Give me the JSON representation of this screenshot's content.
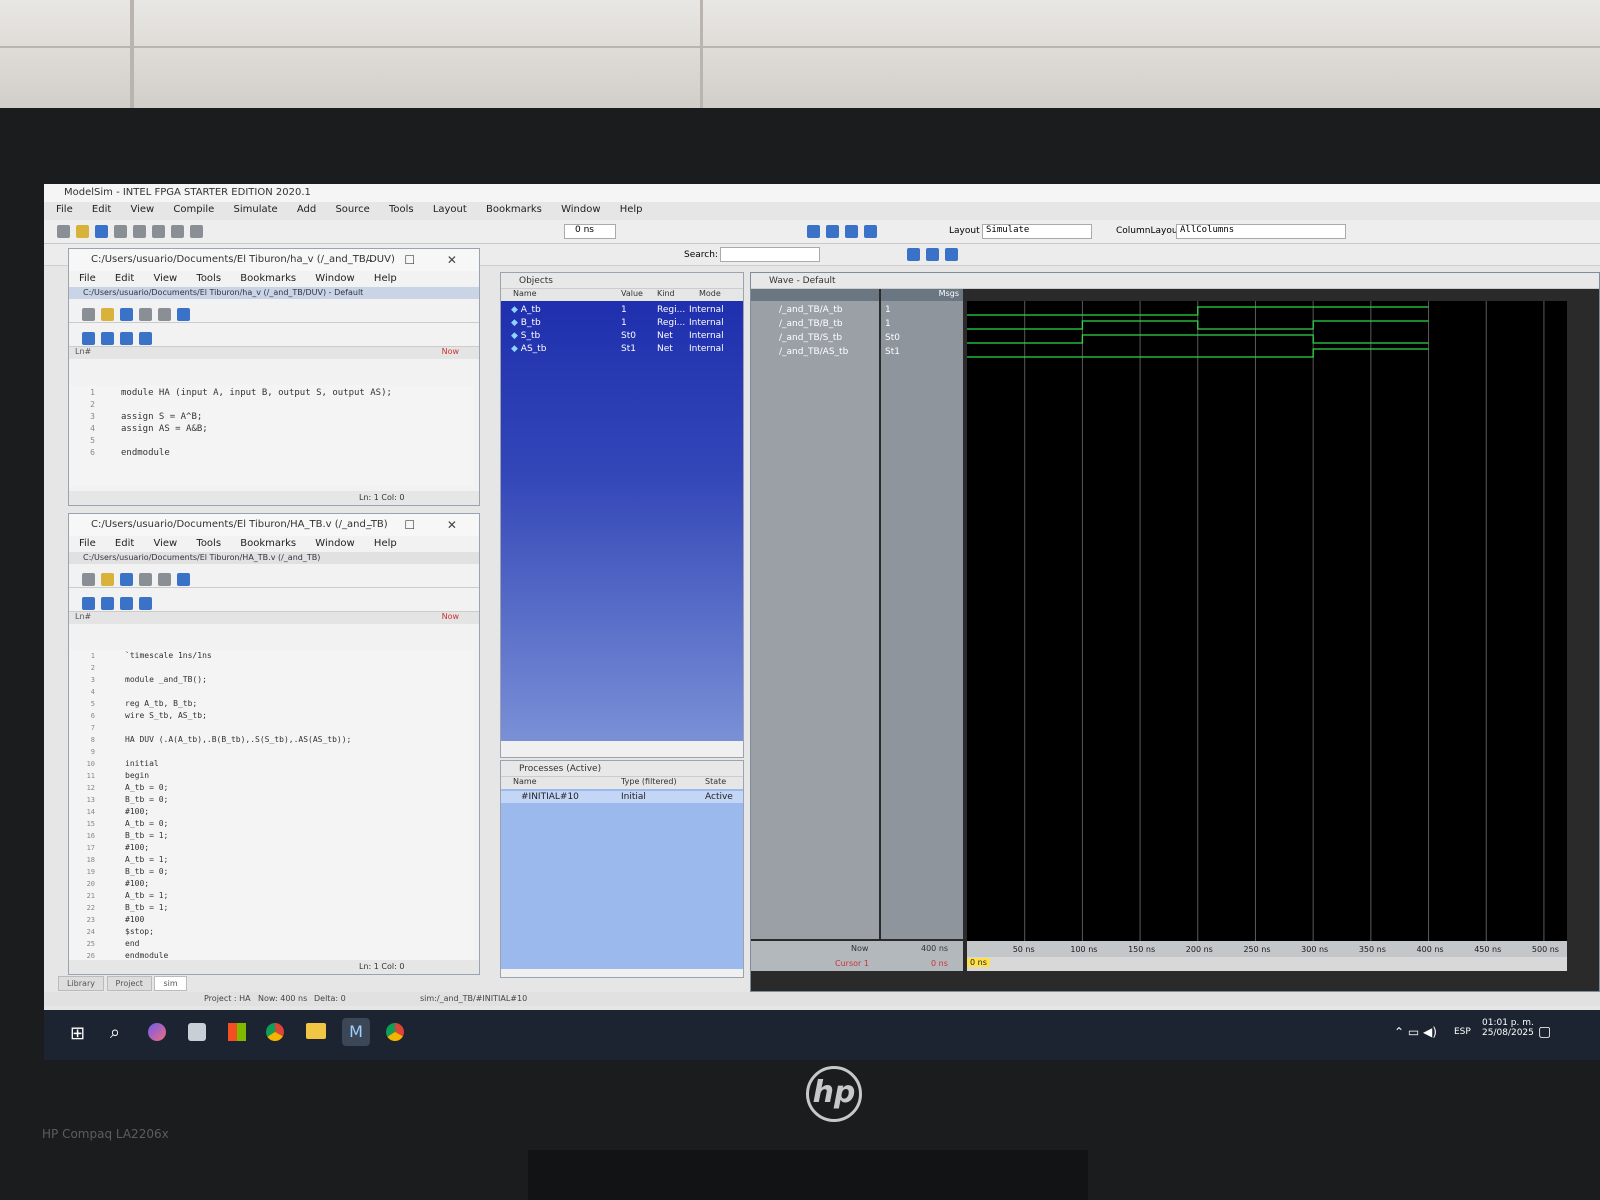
{
  "app": {
    "title": "ModelSim - INTEL FPGA STARTER EDITION 2020.1",
    "menu": [
      "File",
      "Edit",
      "View",
      "Compile",
      "Simulate",
      "Add",
      "Source",
      "Tools",
      "Layout",
      "Bookmarks",
      "Window",
      "Help"
    ],
    "time_field": "0 ns",
    "search_label": "Search:",
    "layout_label": "Layout",
    "layout_value": "Simulate",
    "column_layout_label": "ColumnLayout",
    "column_layout_value": "AllColumns"
  },
  "editor1": {
    "title": "C:/Users/usuario/Documents/El Tiburon/ha_v (/_and_TB/DUV)",
    "menu": [
      "File",
      "Edit",
      "View",
      "Tools",
      "Bookmarks",
      "Window",
      "Help"
    ],
    "inner_title": "C:/Users/usuario/Documents/El Tiburon/ha_v (/_and_TB/DUV) - Default",
    "header": "Ln#",
    "now_label": "Now",
    "line_numbers": "1\n2\n3\n4\n5\n6",
    "code": "module HA (input A, input B, output S, output AS);\n\nassign S = A^B;\nassign AS = A&B;\n\nendmodule",
    "status": "Ln:   1 Col: 0"
  },
  "editor2": {
    "title": "C:/Users/usuario/Documents/El Tiburon/HA_TB.v (/_and_TB)",
    "menu": [
      "File",
      "Edit",
      "View",
      "Tools",
      "Bookmarks",
      "Window",
      "Help"
    ],
    "inner_title": "C:/Users/usuario/Documents/El Tiburon/HA_TB.v (/_and_TB)",
    "header": "Ln#",
    "now_label": "Now",
    "line_numbers": "1\n2\n3\n4\n5\n6\n7\n8\n9\n10\n11\n12\n13\n14\n15\n16\n17\n18\n19\n20\n21\n22\n23\n24\n25\n26",
    "code": "`timescale 1ns/1ns\n\nmodule _and_TB();\n\nreg A_tb, B_tb;\nwire S_tb, AS_tb;\n\nHA DUV (.A(A_tb),.B(B_tb),.S(S_tb),.AS(AS_tb));\n\ninitial\nbegin\nA_tb = 0;\nB_tb = 0;\n#100;\nA_tb = 0;\nB_tb = 1;\n#100;\nA_tb = 1;\nB_tb = 0;\n#100;\nA_tb = 1;\nB_tb = 1;\n#100\n$stop;\nend\nendmodule",
    "status": "Ln:   1 Col: 0"
  },
  "bottom_tabs": [
    "Library",
    "Project",
    "sim"
  ],
  "status_bar": {
    "project": "Project : HA",
    "now": "Now: 400 ns",
    "delta": "Delta: 0",
    "path": "sim:/_and_TB/#INITIAL#10"
  },
  "objects": {
    "title": "Objects",
    "headers": [
      "Name",
      "Value",
      "Kind",
      "Mode"
    ],
    "rows": [
      {
        "name": "A_tb",
        "value": "1",
        "kind": "Regi...",
        "mode": "Internal"
      },
      {
        "name": "B_tb",
        "value": "1",
        "kind": "Regi...",
        "mode": "Internal"
      },
      {
        "name": "S_tb",
        "value": "St0",
        "kind": "Net",
        "mode": "Internal"
      },
      {
        "name": "AS_tb",
        "value": "St1",
        "kind": "Net",
        "mode": "Internal"
      }
    ]
  },
  "processes": {
    "title": "Processes (Active)",
    "headers": [
      "Name",
      "Type (filtered)",
      "State"
    ],
    "rows": [
      {
        "name": "#INITIAL#10",
        "type": "Initial",
        "state": "Active"
      }
    ]
  },
  "wave": {
    "title": "Wave - Default",
    "msgs_label": "Msgs",
    "signals": [
      {
        "name": "/_and_TB/A_tb",
        "value": "1"
      },
      {
        "name": "/_and_TB/B_tb",
        "value": "1"
      },
      {
        "name": "/_and_TB/S_tb",
        "value": "St0"
      },
      {
        "name": "/_and_TB/AS_tb",
        "value": "St1"
      }
    ],
    "now_label": "Now",
    "now_value": "400 ns",
    "cursor_label": "Cursor 1",
    "cursor_value": "0 ns",
    "cursor_tag": "0 ns",
    "ticks": [
      "50 ns",
      "100 ns",
      "150 ns",
      "200 ns",
      "250 ns",
      "300 ns",
      "350 ns",
      "400 ns",
      "450 ns",
      "500 ns"
    ],
    "time_max_ns": 520,
    "sim_end_ns": 400,
    "waveforms": [
      {
        "name": "A_tb",
        "transitions": [
          [
            0,
            0
          ],
          [
            200,
            1
          ]
        ]
      },
      {
        "name": "B_tb",
        "transitions": [
          [
            0,
            0
          ],
          [
            100,
            1
          ],
          [
            200,
            0
          ],
          [
            300,
            1
          ]
        ]
      },
      {
        "name": "S_tb",
        "transitions": [
          [
            0,
            0
          ],
          [
            100,
            1
          ],
          [
            300,
            0
          ]
        ]
      },
      {
        "name": "AS_tb",
        "transitions": [
          [
            0,
            0
          ],
          [
            300,
            1
          ]
        ]
      }
    ],
    "wave_color": "#2fd84a"
  },
  "taskbar": {
    "time": "01:01 p. m.",
    "date": "25/08/2025",
    "lang": "ESP"
  },
  "monitor": {
    "brand": "HP Compaq LA2206x",
    "logo": "hp"
  }
}
